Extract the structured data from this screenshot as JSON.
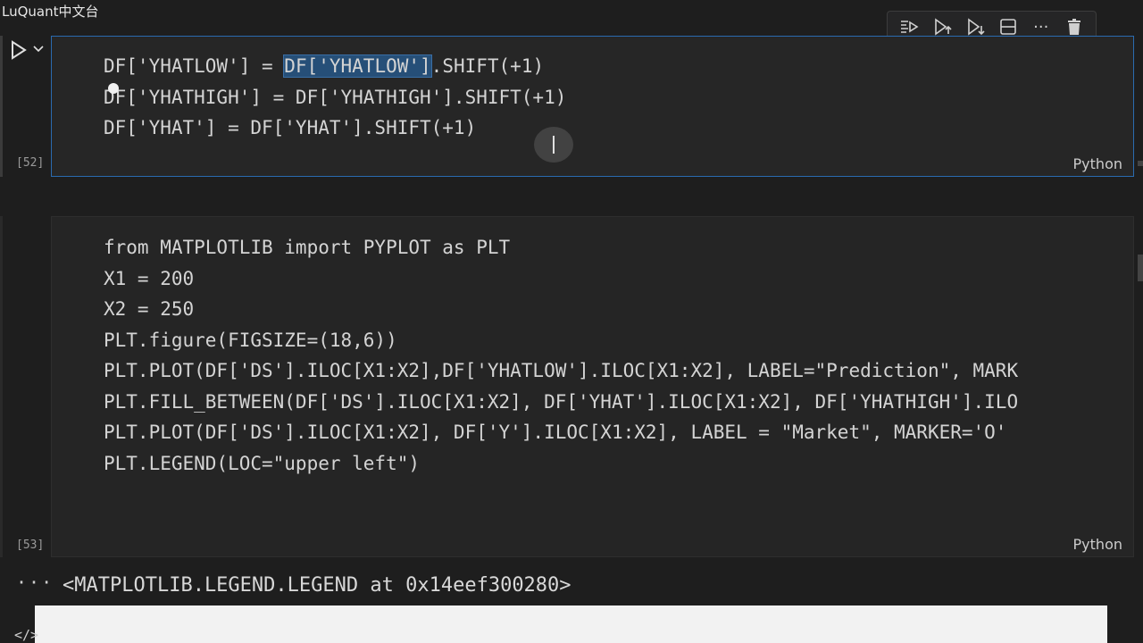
{
  "watermark": "LuQuant中文台",
  "toolbar": {
    "icons": [
      "run-by-line-icon",
      "execute-above-icon",
      "execute-below-icon",
      "split-cell-icon",
      "more-icon",
      "delete-icon"
    ],
    "more_label": "···"
  },
  "cell1": {
    "exec_count": "[52]",
    "language": "Python",
    "lines": [
      {
        "pre": "DF['YHATLOW'] = ",
        "sel": "DF['YHATLOW']",
        "post": ".SHIFT(+1)"
      },
      {
        "text": "DF['YHATHIGH'] = DF['YHATHIGH'].SHIFT(+1)"
      },
      {
        "text": "DF['YHAT'] = DF['YHAT'].SHIFT(+1)"
      }
    ]
  },
  "cell2": {
    "exec_count": "[53]",
    "language": "Python",
    "lines": [
      "from MATPLOTLIB import PYPLOT as PLT",
      "X1 = 200",
      "X2 = 250",
      "PLT.figure(FIGSIZE=(18,6))",
      "PLT.PLOT(DF['DS'].ILOC[X1:X2],DF['YHATLOW'].ILOC[X1:X2], LABEL=\"Prediction\", MARK",
      "PLT.FILL_BETWEEN(DF['DS'].ILOC[X1:X2], DF['YHAT'].ILOC[X1:X2], DF['YHATHIGH'].ILO",
      "PLT.PLOT(DF['DS'].ILOC[X1:X2], DF['Y'].ILOC[X1:X2], LABEL = \"Market\", MARKER='O'",
      "PLT.LEGEND(LOC=\"upper left\")"
    ]
  },
  "output": {
    "dots": "···",
    "text": "<MATPLOTLIB.LEGEND.LEGEND at 0x14eef300280>",
    "code_tag": "</>"
  },
  "colors": {
    "background": "#1e1e1e",
    "focus_border": "#2a6bb0",
    "selection": "#264f78"
  }
}
